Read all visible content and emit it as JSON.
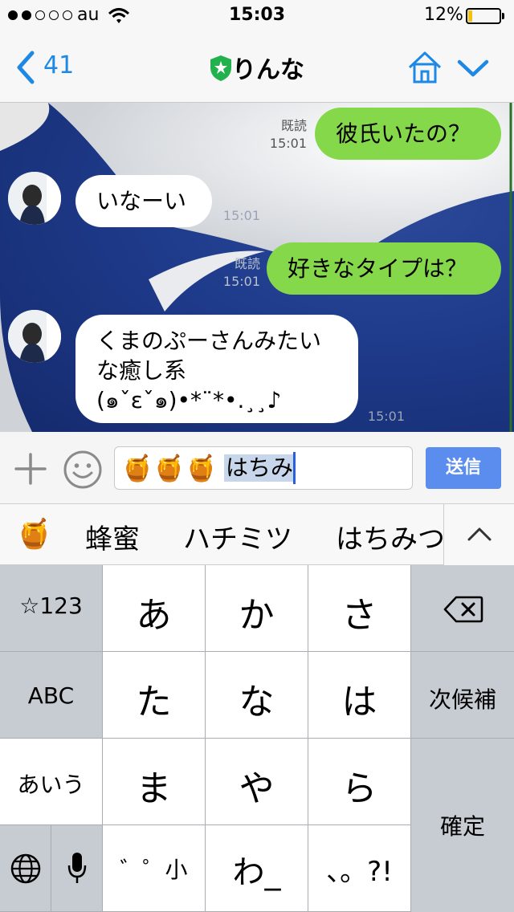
{
  "status_bar": {
    "carrier": "au",
    "time": "15:03",
    "battery_percent": "12%",
    "battery_level": 0.12,
    "signal_bars_filled": 2,
    "signal_bars_total": 5
  },
  "nav": {
    "back_count": "41",
    "title": "りんな",
    "accent_color": "#1e88e5",
    "shield_color": "#22b14c"
  },
  "messages": [
    {
      "side": "me",
      "text": "彼氏いたの？",
      "read": "既読",
      "time": "15:01"
    },
    {
      "side": "them",
      "text": "いなーい",
      "time": "15:01"
    },
    {
      "side": "me",
      "text": "好きなタイプは？",
      "read": "既読",
      "time": "15:01"
    },
    {
      "side": "them",
      "line1": "くまのぷーさんみたい",
      "line2": "な癒し系",
      "line3": "(๑ˇεˇ๑)•*¨*•.¸¸♪",
      "time": "15:01"
    }
  ],
  "input": {
    "emoji": "🍯🍯🍯",
    "composing_text": "はちみ",
    "send_label": "送信"
  },
  "candidates": [
    "🍯",
    "蜂蜜",
    "ハチミツ",
    "はちみつ"
  ],
  "keyboard": {
    "col1": [
      "☆123",
      "ABC",
      "あいう"
    ],
    "rows": [
      [
        "あ",
        "か",
        "さ"
      ],
      [
        "た",
        "な",
        "は"
      ],
      [
        "ま",
        "や",
        "ら"
      ],
      [
        "゛゜小",
        "わ_",
        "、。?!"
      ]
    ],
    "next_candidate": "次候補",
    "confirm": "確定"
  },
  "colors": {
    "my_bubble": "#84d84a",
    "their_bubble": "#ffffff",
    "send_button": "#5b8def",
    "chat_bg": "#1e3a8a"
  }
}
